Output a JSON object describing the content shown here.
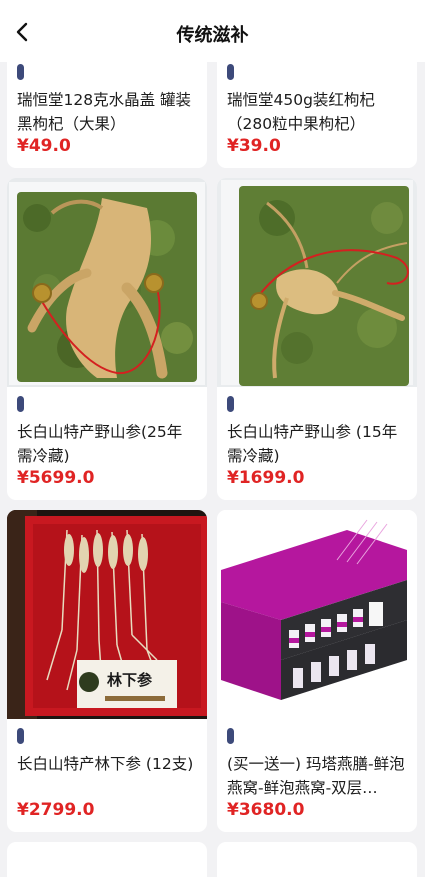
{
  "header": {
    "title": "传统滋补",
    "back_icon": "chevron-left-icon"
  },
  "colors": {
    "price": "#e02424",
    "accent_mark": "#3d4a7a",
    "background": "#f2f2f4"
  },
  "products": [
    {
      "name": "瑞恒堂128克水晶盖 罐装黑枸杞（大果）",
      "price": "¥49.0",
      "image": "goji-jar"
    },
    {
      "name": "瑞恒堂450g装红枸杞（280粒中果枸杞）",
      "price": "¥39.0",
      "image": "goji-jar"
    },
    {
      "name": "长白山特产野山参(25年需冷藏)",
      "price": "¥5699.0",
      "image": "wild-ginseng-moss-box"
    },
    {
      "name": "长白山特产野山参 (15年需冷藏)",
      "price": "¥1699.0",
      "image": "wild-ginseng-moss-box"
    },
    {
      "name": "长白山特产林下参 (12支)",
      "price": "¥2799.0",
      "image": "forest-ginseng-red-box",
      "image_sign": "林下参"
    },
    {
      "name": "(买一送一) 玛塔燕膳-鲜泡燕窝-鲜泡燕窝-双层…",
      "price": "¥3680.0",
      "image": "birds-nest-gift-box"
    }
  ]
}
